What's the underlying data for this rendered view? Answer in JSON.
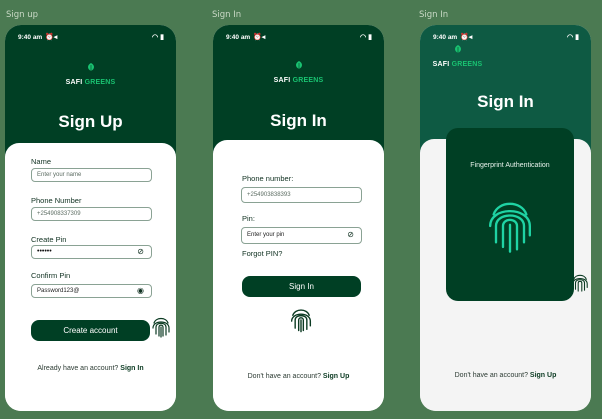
{
  "frames": [
    {
      "label": "Sign up",
      "status": {
        "time": "9:40 am"
      },
      "logo": {
        "part1": "SAFI",
        "part2": "GREENS"
      },
      "title": "Sign Up",
      "fields": {
        "name": {
          "label": "Name",
          "placeholder": "Enter your name"
        },
        "phone": {
          "label": "Phone Number",
          "value": "+254908337309"
        },
        "create_pin": {
          "label": "Create Pin",
          "value": "••••••"
        },
        "confirm_pin": {
          "label": "Confirm Pin",
          "value": "Password123@"
        }
      },
      "button": "Create account",
      "footer": {
        "text": "Already have an account?",
        "link": "Sign In"
      }
    },
    {
      "label": "Sign In",
      "status": {
        "time": "9:40 am"
      },
      "logo": {
        "part1": "SAFI",
        "part2": "GREENS"
      },
      "title": "Sign In",
      "fields": {
        "phone": {
          "label": "Phone number:",
          "value": "+254903838393"
        },
        "pin": {
          "label": "Pin:",
          "placeholder": "Enter your pin"
        }
      },
      "forgot": "Forgot PIN?",
      "button": "Sign In",
      "footer": {
        "text": "Don't have an account?",
        "link": "Sign Up"
      }
    },
    {
      "label": "Sign In",
      "status": {
        "time": "9:40 am"
      },
      "logo": {
        "part1": "SAFI",
        "part2": "GREENS"
      },
      "title": "Sign In",
      "modal": {
        "title": "Fingerprint Authentication"
      },
      "footer": {
        "text": "Don't have an account?",
        "link": "Sign Up"
      }
    }
  ],
  "colors": {
    "brand_dark": "#003f24",
    "brand_teal": "#0e5a43",
    "accent_green": "#19c271",
    "page_bg": "#4b7a52",
    "fingerprint": "#1fd3a4"
  },
  "icons": [
    "signal-icon",
    "alarm-icon",
    "wifi-icon",
    "battery-icon",
    "eye-slash-icon",
    "eye-icon",
    "fingerprint-icon",
    "leaf-logo-icon"
  ]
}
